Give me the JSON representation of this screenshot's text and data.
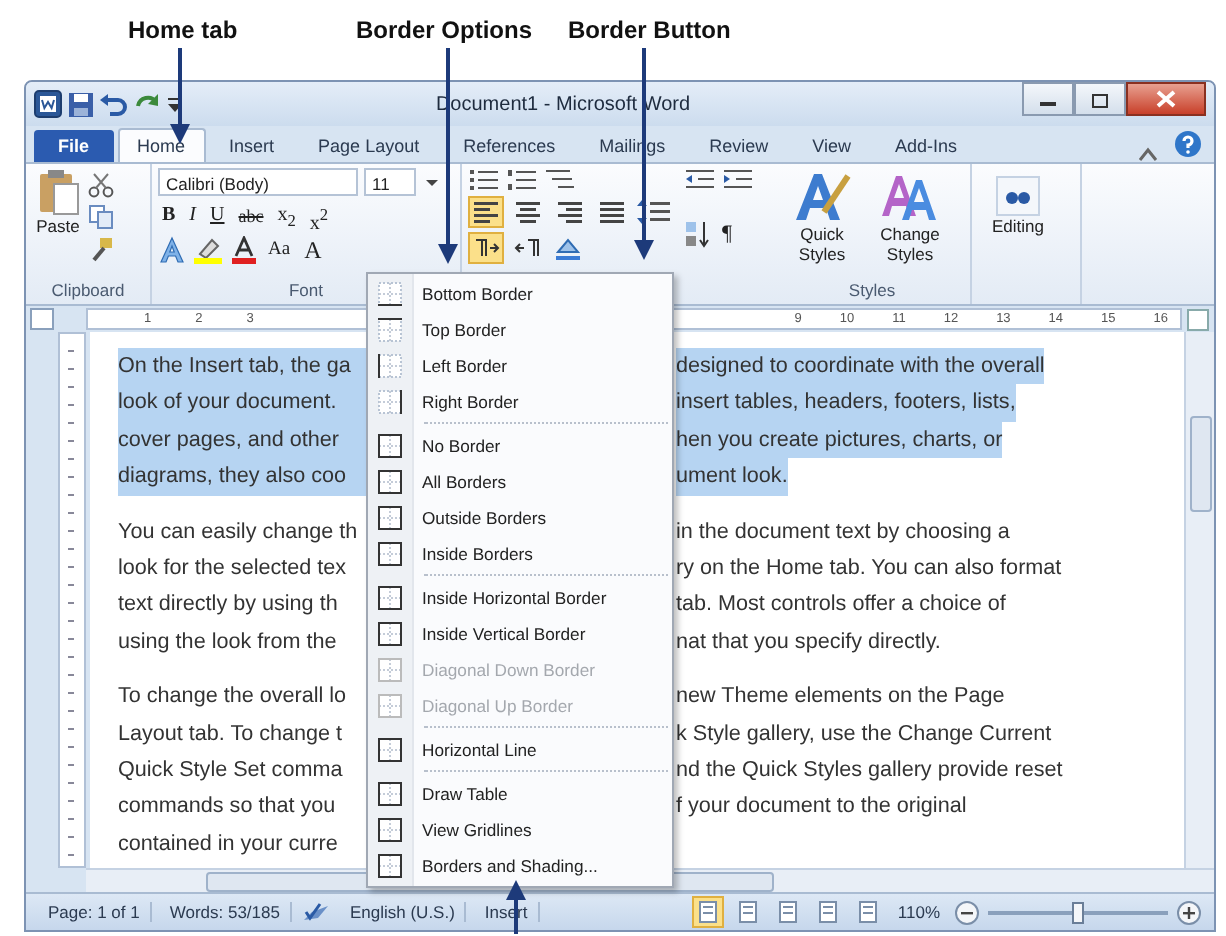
{
  "annotations": [
    {
      "text": "Home tab"
    },
    {
      "text": "Border Options"
    },
    {
      "text": "Border Button"
    }
  ],
  "window": {
    "title": "Document1 - Microsoft Word"
  },
  "tabs": [
    {
      "label": "File",
      "kind": "file",
      "selected": false
    },
    {
      "label": "Home",
      "kind": "tab",
      "selected": true
    },
    {
      "label": "Insert",
      "kind": "tab",
      "selected": false
    },
    {
      "label": "Page Layout",
      "kind": "tab",
      "selected": false
    },
    {
      "label": "References",
      "kind": "tab",
      "selected": false
    },
    {
      "label": "Mailings",
      "kind": "tab",
      "selected": false
    },
    {
      "label": "Review",
      "kind": "tab",
      "selected": false
    },
    {
      "label": "View",
      "kind": "tab",
      "selected": false
    },
    {
      "label": "Add-Ins",
      "kind": "tab",
      "selected": false
    }
  ],
  "ribbon": {
    "clipboard": {
      "paste": "Paste",
      "group": "Clipboard"
    },
    "font": {
      "name": "Calibri (Body)",
      "size": "11",
      "group": "Font",
      "buttons": [
        "B",
        "I",
        "U",
        "abc",
        "x$_{2}$",
        "x$^{2}$"
      ],
      "row2": [
        "Aa",
        "A"
      ]
    },
    "paragraph": {
      "align": [
        {
          "selected": true
        },
        {
          "selected": false
        },
        {
          "selected": false
        },
        {
          "selected": false
        }
      ],
      "ltr": {
        "selected": true
      },
      "rtl": {
        "selected": false
      },
      "pilcrow": "¶"
    },
    "styles": {
      "quick": "Quick Styles",
      "change": "Change Styles",
      "group": "Styles"
    },
    "editing": "Editing"
  },
  "ruler": {
    "left_numbers": [
      "1",
      "2",
      "3"
    ],
    "right_numbers": [
      "9",
      "10",
      "11",
      "12",
      "13",
      "14",
      "15",
      "16"
    ]
  },
  "document": {
    "paragraphs": [
      {
        "selected": true,
        "lines": [
          [
            "On the Insert tab, the ga",
            "designed to coordinate with the overall"
          ],
          [
            "look of your document.",
            "insert tables, headers, footers, lists,"
          ],
          [
            "cover pages, and other",
            "hen you create pictures, charts, or"
          ],
          [
            "diagrams, they also coo",
            "ument look."
          ]
        ]
      },
      {
        "selected": false,
        "lines": [
          [
            "You can easily change th",
            "in the document text by choosing a"
          ],
          [
            "look for the selected tex",
            "ry on the Home tab. You can also format"
          ],
          [
            "text directly by using th",
            "tab. Most controls offer a choice of"
          ],
          [
            "using the look from the",
            "nat that you specify directly."
          ]
        ]
      },
      {
        "selected": false,
        "lines": [
          [
            "To change the overall lo",
            "new Theme elements on the Page"
          ],
          [
            "Layout tab. To change t",
            "k Style gallery, use the Change Current"
          ],
          [
            "Quick Style Set comma",
            "nd the Quick Styles gallery provide reset"
          ],
          [
            "commands so that you",
            "f your document to the original"
          ],
          [
            "contained in your curre"
          ]
        ]
      }
    ]
  },
  "border_menu": [
    {
      "kind": "item",
      "label": "Bottom Border",
      "disabled": false
    },
    {
      "kind": "item",
      "label": "Top Border",
      "disabled": false
    },
    {
      "kind": "item",
      "label": "Left Border",
      "disabled": false
    },
    {
      "kind": "item",
      "label": "Right Border",
      "disabled": false
    },
    {
      "kind": "separator"
    },
    {
      "kind": "item",
      "label": "No Border",
      "disabled": false
    },
    {
      "kind": "item",
      "label": "All Borders",
      "disabled": false
    },
    {
      "kind": "item",
      "label": "Outside Borders",
      "disabled": false
    },
    {
      "kind": "item",
      "label": "Inside Borders",
      "disabled": false
    },
    {
      "kind": "separator"
    },
    {
      "kind": "item",
      "label": "Inside Horizontal Border",
      "disabled": false
    },
    {
      "kind": "item",
      "label": "Inside Vertical Border",
      "disabled": false
    },
    {
      "kind": "item",
      "label": "Diagonal Down Border",
      "disabled": true
    },
    {
      "kind": "item",
      "label": "Diagonal Up Border",
      "disabled": true
    },
    {
      "kind": "separator"
    },
    {
      "kind": "item",
      "label": "Horizontal Line",
      "disabled": false
    },
    {
      "kind": "separator"
    },
    {
      "kind": "item",
      "label": "Draw Table",
      "disabled": false
    },
    {
      "kind": "item",
      "label": "View Gridlines",
      "disabled": false
    },
    {
      "kind": "item",
      "label": "Borders and Shading...",
      "disabled": false
    }
  ],
  "status_bar": {
    "page": "Page: 1 of 1",
    "words": "Words: 53/185",
    "language": "English (U.S.)",
    "mode": "Insert",
    "views": [
      {
        "selected": true
      },
      {
        "selected": false
      },
      {
        "selected": false
      },
      {
        "selected": false
      },
      {
        "selected": false
      }
    ],
    "zoom": "110%",
    "level": 0.5
  }
}
